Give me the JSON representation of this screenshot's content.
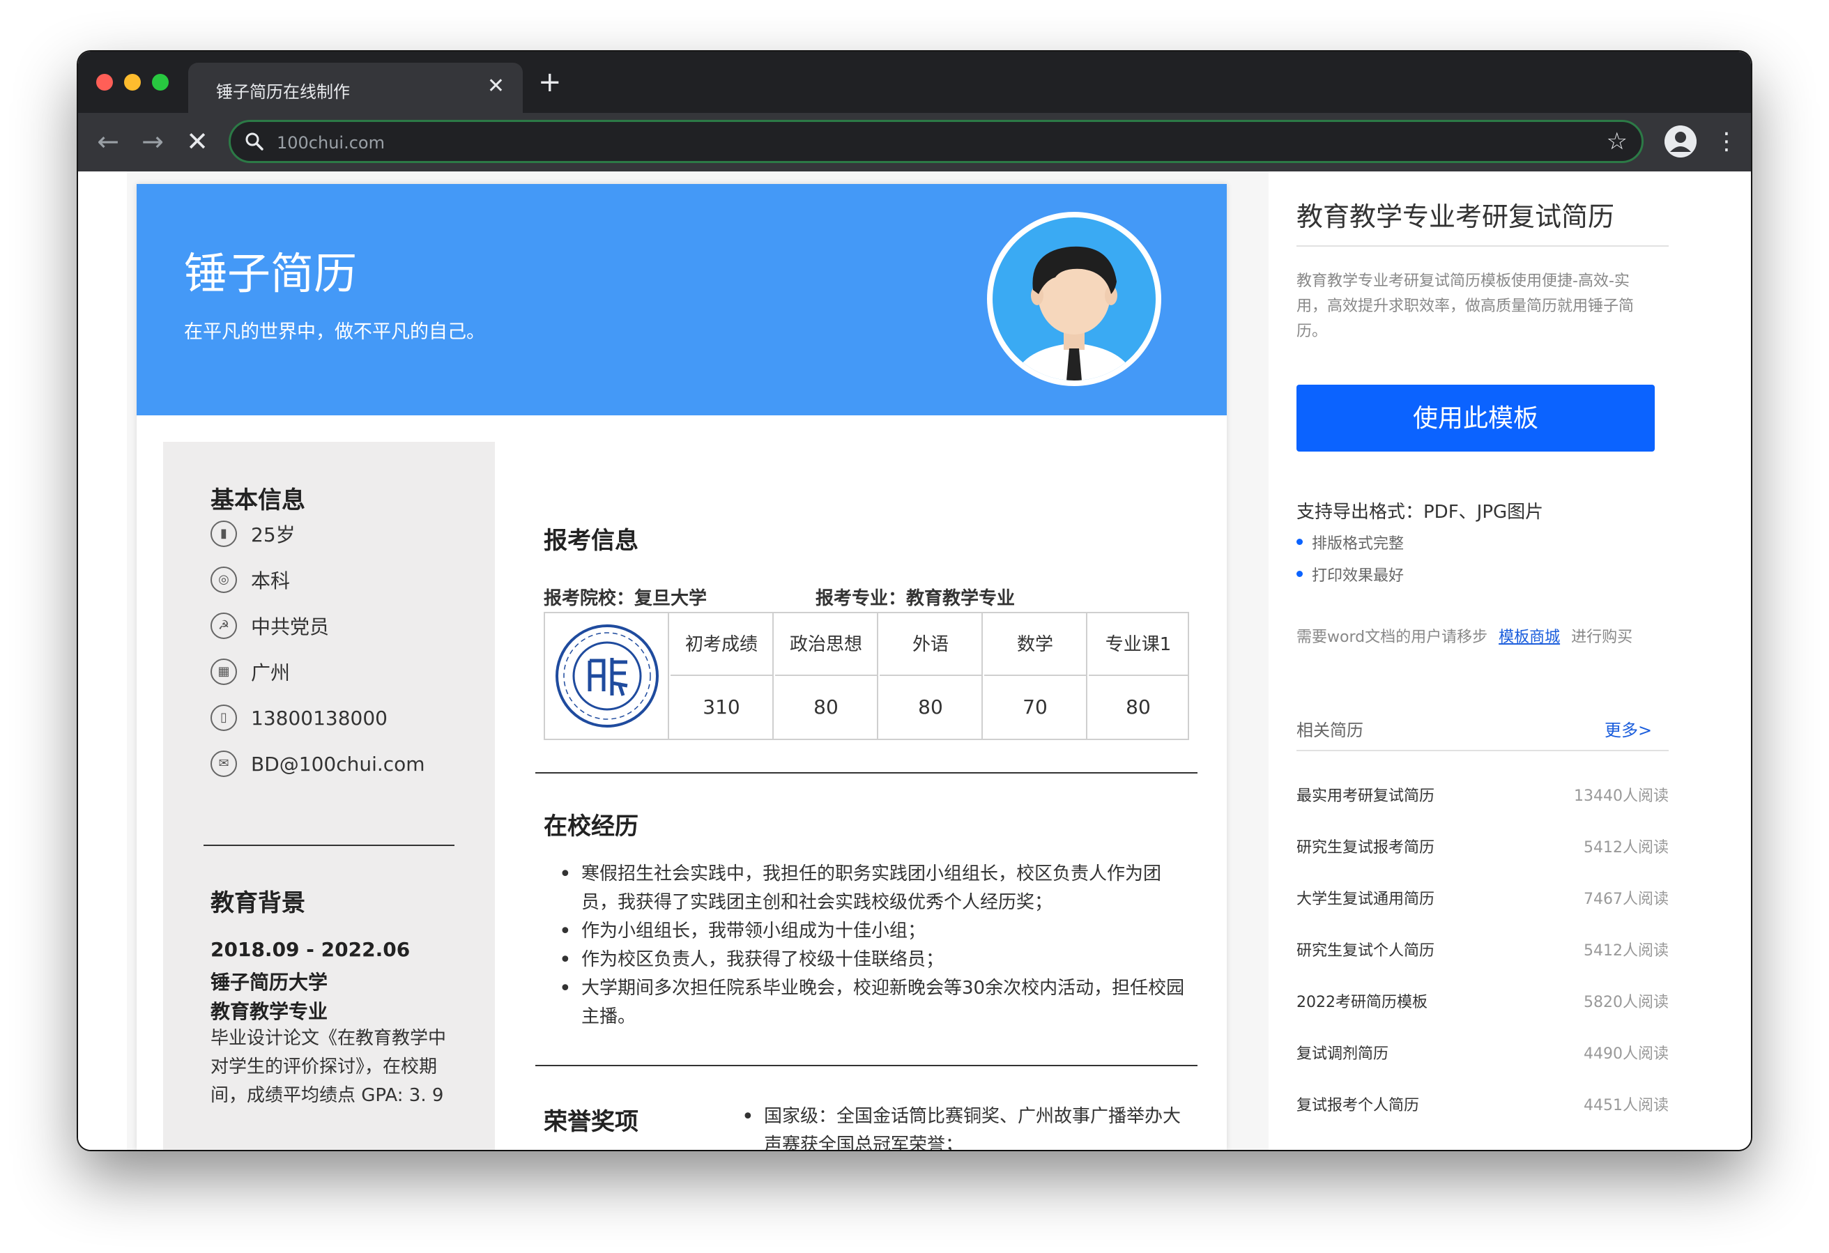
{
  "browser": {
    "tab_title": "锤子简历在线制作",
    "close_glyph": "✕",
    "new_tab_glyph": "+",
    "url": "100chui.com",
    "back_glyph": "←",
    "forward_glyph": "→",
    "stop_glyph": "✕",
    "star_glyph": "☆",
    "menu_glyph": "⋮"
  },
  "resume": {
    "name": "锤子简历",
    "motto": "在平凡的世界中，做不平凡的自己。",
    "basic_title": "基本信息",
    "basic_info": [
      {
        "icon": "chart-icon",
        "text": "25岁"
      },
      {
        "icon": "degree-icon",
        "text": "本科"
      },
      {
        "icon": "party-icon",
        "text": "中共党员"
      },
      {
        "icon": "building-icon",
        "text": "广州"
      },
      {
        "icon": "phone-icon",
        "text": "13800138000"
      },
      {
        "icon": "mail-icon",
        "text": "BD@100chui.com"
      }
    ],
    "edu_title": "教育背景",
    "edu_period": "2018.09 - 2022.06",
    "edu_school": "锤子简历大学",
    "edu_major": "教育教学专业",
    "edu_desc": "毕业设计论文《在教育教学中对学生的评价探讨》，在校期间，成绩平均绩点 GPA: 3. 9",
    "apply_title": "报考信息",
    "apply_school": "报考院校：复旦大学",
    "apply_major": "报考专业：教育教学专业",
    "score_headers": [
      "初考成绩",
      "政治思想",
      "外语",
      "数学",
      "专业课1"
    ],
    "score_values": [
      "310",
      "80",
      "80",
      "70",
      "80"
    ],
    "school_title": "在校经历",
    "school_items": [
      "寒假招生社会实践中，我担任的职务实践团小组组长，校区负责人作为团员，我获得了实践团主创和社会实践校级优秀个人经历奖；",
      "作为小组组长，我带领小组成为十佳小组；",
      "作为校区负责人，我获得了校级十佳联络员；",
      "大学期间多次担任院系毕业晚会，校迎新晚会等30余次校内活动，担任校园主播。"
    ],
    "honor_title": "荣誉奖项",
    "honor_items": [
      "国家级：全国金话筒比赛铜奖、广州故事广播举办大声赛获全国总冠军荣誉；"
    ]
  },
  "sidebar": {
    "title": "教育教学专业考研复试简历",
    "desc": "教育教学专业考研复试简历模板使用便捷-高效-实用，高效提升求职效率，做高质量简历就用锤子简历。",
    "use_button": "使用此模板",
    "export_formats": "支持导出格式：PDF、JPG图片",
    "features": [
      "排版格式完整",
      "打印效果最好"
    ],
    "word_prefix": "需要word文档的用户请移步",
    "word_link": "模板商城",
    "word_suffix": "进行购买",
    "related_title": "相关简历",
    "more": "更多>",
    "related": [
      {
        "name": "最实用考研复试简历",
        "count": "13440人阅读"
      },
      {
        "name": "研究生复试报考简历",
        "count": "5412人阅读"
      },
      {
        "name": "大学生复试通用简历",
        "count": "7467人阅读"
      },
      {
        "name": "研究生复试个人简历",
        "count": "5412人阅读"
      },
      {
        "name": "2022考研简历模板",
        "count": "5820人阅读"
      },
      {
        "name": "复试调剂简历",
        "count": "4490人阅读"
      },
      {
        "name": "复试报考个人简历",
        "count": "4451人阅读"
      }
    ]
  },
  "colors": {
    "banner": "#4499f7",
    "button": "#0b63ff",
    "link": "#1a5ddc"
  }
}
